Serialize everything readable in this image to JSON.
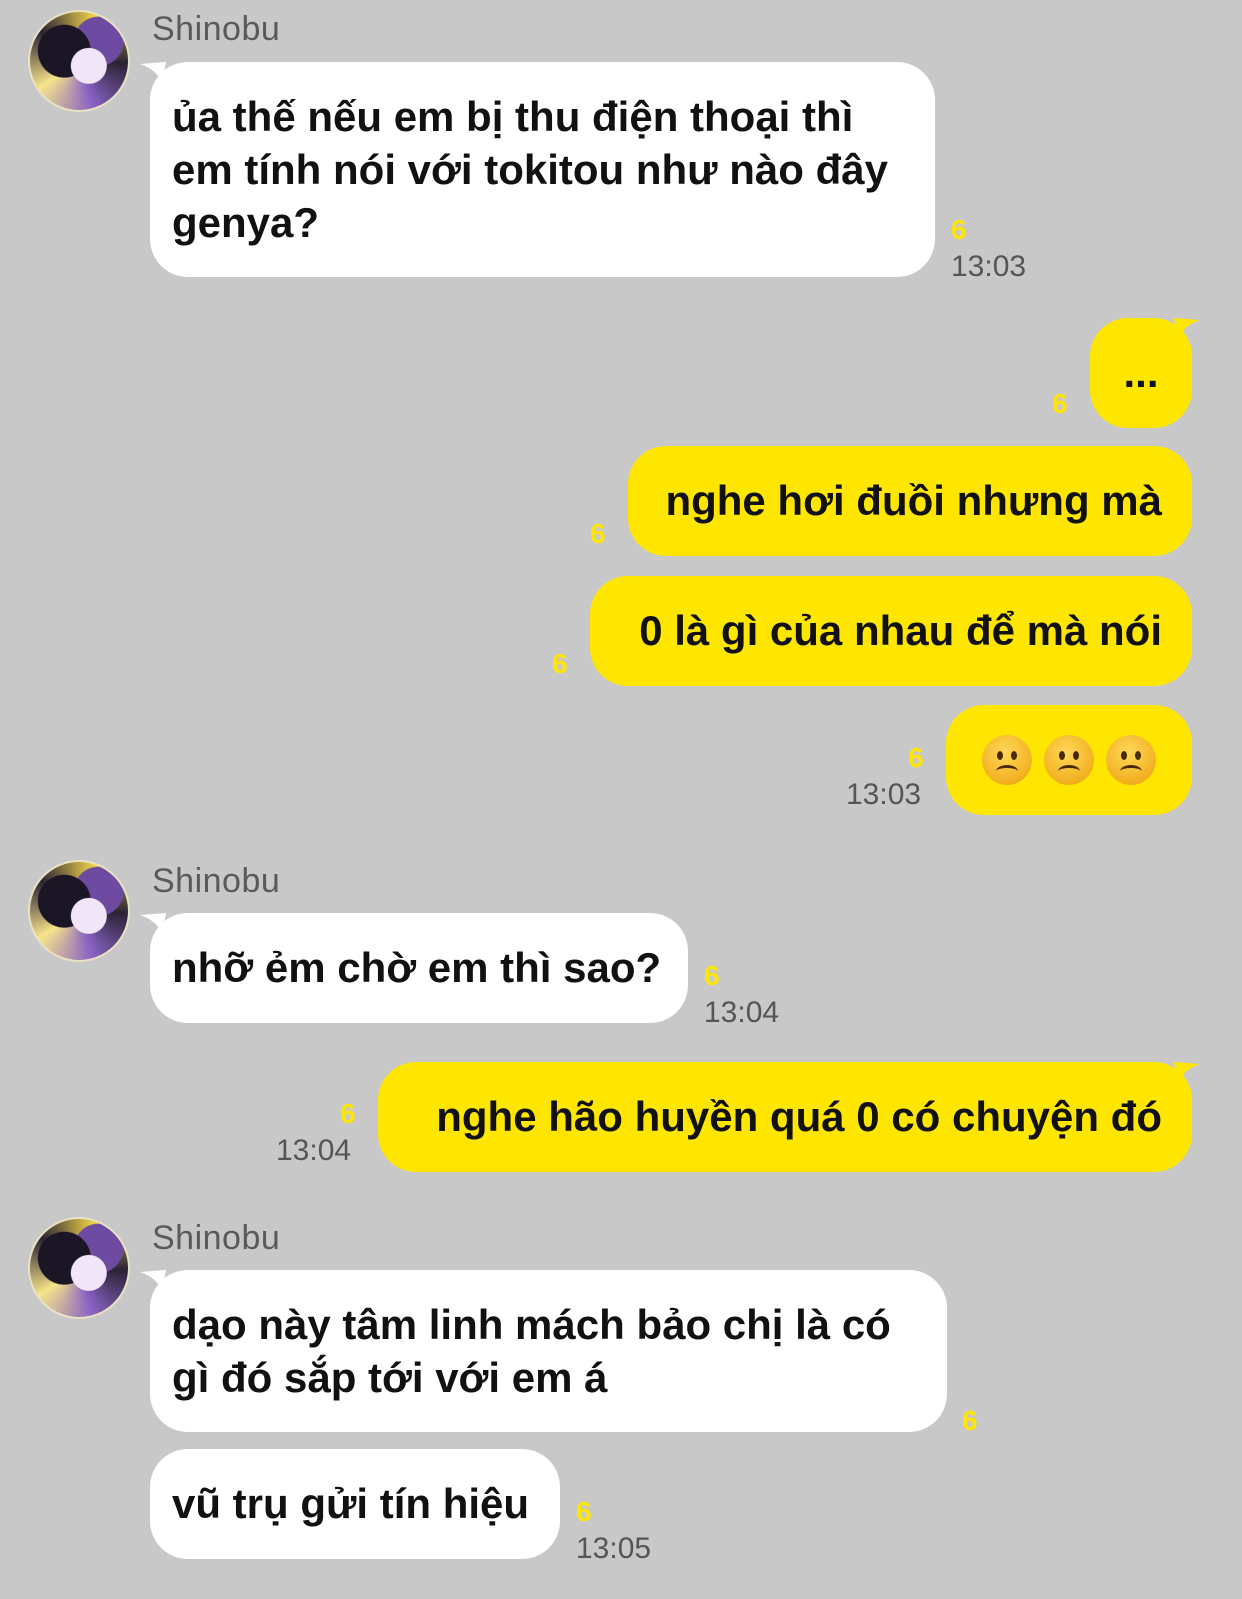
{
  "contact": {
    "name": "Shinobu"
  },
  "colors": {
    "background": "#c8c8c8",
    "incoming_bubble": "#ffffff",
    "outgoing_bubble": "#ffe600",
    "unread_count": "#ffe600"
  },
  "messages": [
    {
      "direction": "in",
      "text": "ủa thế nếu em bị thu điện thoại thì\nem tính nói với tokitou như nào đây\ngenya?",
      "unread": "6",
      "time": "13:03"
    },
    {
      "direction": "out",
      "text": "...",
      "unread": "6",
      "time": ""
    },
    {
      "direction": "out",
      "text": "nghe hơi đuồi nhưng mà",
      "unread": "6",
      "time": ""
    },
    {
      "direction": "out",
      "text": "0 là gì của nhau để mà nói",
      "unread": "6",
      "time": ""
    },
    {
      "direction": "out",
      "emoji": [
        "frowning-face-icon",
        "frowning-face-icon",
        "frowning-face-icon"
      ],
      "unread": "6",
      "time": "13:03"
    },
    {
      "direction": "in",
      "text": "nhỡ ẻm chờ em thì sao?",
      "unread": "6",
      "time": "13:04"
    },
    {
      "direction": "out",
      "text": "nghe hão huyền quá 0 có chuyện đó",
      "unread": "6",
      "time": "13:04"
    },
    {
      "direction": "in",
      "text": "dạo này tâm linh mách bảo chị là có\ngì đó sắp tới với em á",
      "unread": "6",
      "time": ""
    },
    {
      "direction": "in",
      "text": "vũ trụ gửi tín hiệu",
      "unread": "6",
      "time": "13:05"
    }
  ]
}
